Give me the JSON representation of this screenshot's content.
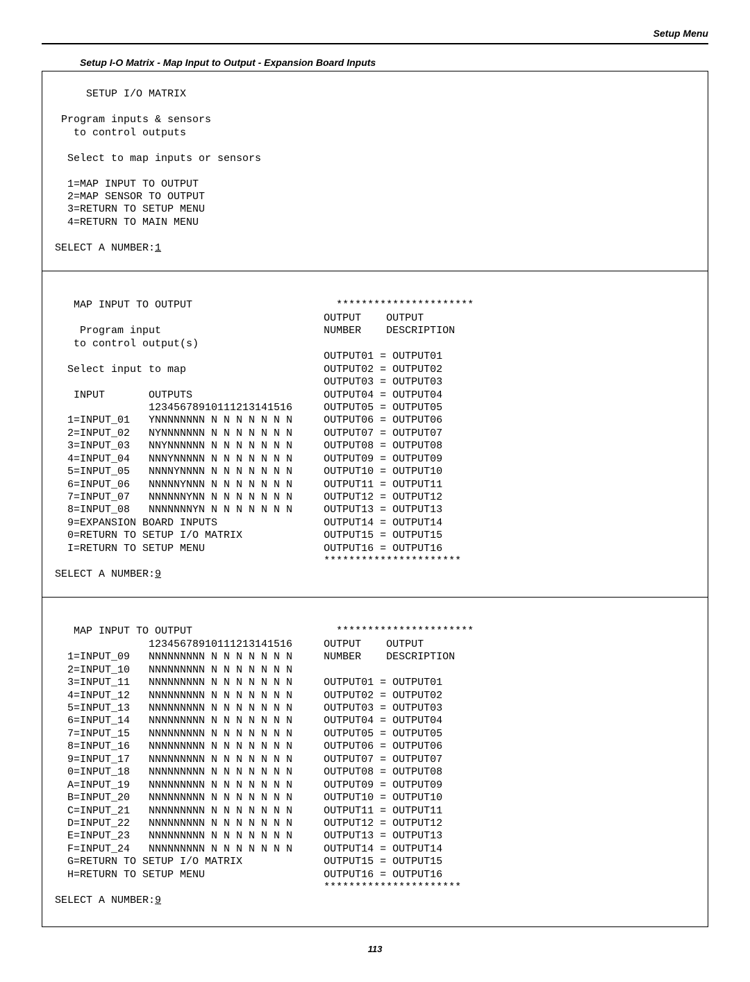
{
  "header": {
    "right": "Setup Menu"
  },
  "section_caption": "Setup I-O Matrix - Map Input to Output - Expansion Board Inputs",
  "page_number": "113",
  "block_a": {
    "title": "     SETUP I/O MATRIX",
    "lines": [
      " Program inputs & sensors",
      "   to control outputs",
      "",
      "  Select to map inputs or sensors",
      "",
      "  1=MAP INPUT TO OUTPUT",
      "  2=MAP SENSOR TO OUTPUT",
      "  3=RETURN TO SETUP MENU",
      "  4=RETURN TO MAIN MENU"
    ],
    "prompt": "SELECT A NUMBER:",
    "prompt_value": "1"
  },
  "block_b": {
    "stars": "**********************",
    "title": "   MAP INPUT TO OUTPUT",
    "hdr1": "OUTPUT    OUTPUT",
    "hdr2": "NUMBER    DESCRIPTION",
    "sub1": "    Program input",
    "sub2": "   to control output(s)",
    "sub3": "  Select input to map",
    "col_hdr_l": "   INPUT       OUTPUTS",
    "col_hdr_r": "OUTPUT04 = OUTPUT04",
    "numline": "               12345678910111213141516",
    "out_right_a": "OUTPUT01 = OUTPUT01",
    "out_right_b": "OUTPUT02 = OUTPUT02",
    "out_right_c": "OUTPUT03 = OUTPUT03",
    "out_right_e": "OUTPUT05 = OUTPUT05",
    "rows": [
      {
        "l": "  1=INPUT_01   YNNNNNNNN N N N N N N N",
        "r": "OUTPUT06 = OUTPUT06"
      },
      {
        "l": "  2=INPUT_02   NYNNNNNNN N N N N N N N",
        "r": "OUTPUT07 = OUTPUT07"
      },
      {
        "l": "  3=INPUT_03   NNYNNNNNN N N N N N N N",
        "r": "OUTPUT08 = OUTPUT08"
      },
      {
        "l": "  4=INPUT_04   NNNYNNNNN N N N N N N N",
        "r": "OUTPUT09 = OUTPUT09"
      },
      {
        "l": "  5=INPUT_05   NNNNYNNNN N N N N N N N",
        "r": "OUTPUT10 = OUTPUT10"
      },
      {
        "l": "  6=INPUT_06   NNNNNYNNN N N N N N N N",
        "r": "OUTPUT11 = OUTPUT11"
      },
      {
        "l": "  7=INPUT_07   NNNNNNYNN N N N N N N N",
        "r": "OUTPUT12 = OUTPUT12"
      },
      {
        "l": "  8=INPUT_08   NNNNNNNYN N N N N N N N",
        "r": "OUTPUT13 = OUTPUT13"
      },
      {
        "l": "  9=EXPANSION BOARD INPUTS",
        "r": "OUTPUT14 = OUTPUT14"
      },
      {
        "l": "  0=RETURN TO SETUP I/O MATRIX",
        "r": "OUTPUT15 = OUTPUT15"
      },
      {
        "l": "  I=RETURN TO SETUP MENU",
        "r": "OUTPUT16 = OUTPUT16"
      }
    ],
    "prompt": "SELECT A NUMBER:",
    "prompt_value": "9"
  },
  "block_c": {
    "stars": "**********************",
    "title": "   MAP INPUT TO OUTPUT",
    "numline_l": "               12345678910111213141516",
    "numline_r": "OUTPUT    OUTPUT",
    "line2_l": "  1=INPUT_09   NNNNNNNNN N N N N N N N",
    "line2_r": "NUMBER    DESCRIPTION",
    "line3": "  2=INPUT_10   NNNNNNNNN N N N N N N N",
    "rows": [
      {
        "l": "  3=INPUT_11   NNNNNNNNN N N N N N N N",
        "r": "OUTPUT01 = OUTPUT01"
      },
      {
        "l": "  4=INPUT_12   NNNNNNNNN N N N N N N N",
        "r": "OUTPUT02 = OUTPUT02"
      },
      {
        "l": "  5=INPUT_13   NNNNNNNNN N N N N N N N",
        "r": "OUTPUT03 = OUTPUT03"
      },
      {
        "l": "  6=INPUT_14   NNNNNNNNN N N N N N N N",
        "r": "OUTPUT04 = OUTPUT04"
      },
      {
        "l": "  7=INPUT_15   NNNNNNNNN N N N N N N N",
        "r": "OUTPUT05 = OUTPUT05"
      },
      {
        "l": "  8=INPUT_16   NNNNNNNNN N N N N N N N",
        "r": "OUTPUT06 = OUTPUT06"
      },
      {
        "l": "  9=INPUT_17   NNNNNNNNN N N N N N N N",
        "r": "OUTPUT07 = OUTPUT07"
      },
      {
        "l": "  0=INPUT_18   NNNNNNNNN N N N N N N N",
        "r": "OUTPUT08 = OUTPUT08"
      },
      {
        "l": "  A=INPUT_19   NNNNNNNNN N N N N N N N",
        "r": "OUTPUT09 = OUTPUT09"
      },
      {
        "l": "  B=INPUT_20   NNNNNNNNN N N N N N N N",
        "r": "OUTPUT10 = OUTPUT10"
      },
      {
        "l": "  C=INPUT_21   NNNNNNNNN N N N N N N N",
        "r": "OUTPUT11 = OUTPUT11"
      },
      {
        "l": "  D=INPUT_22   NNNNNNNNN N N N N N N N",
        "r": "OUTPUT12 = OUTPUT12"
      },
      {
        "l": "  E=INPUT_23   NNNNNNNNN N N N N N N N",
        "r": "OUTPUT13 = OUTPUT13"
      },
      {
        "l": "  F=INPUT_24   NNNNNNNNN N N N N N N N",
        "r": "OUTPUT14 = OUTPUT14"
      },
      {
        "l": "  G=RETURN TO SETUP I/O MATRIX",
        "r": "OUTPUT15 = OUTPUT15"
      },
      {
        "l": "  H=RETURN TO SETUP MENU",
        "r": "OUTPUT16 = OUTPUT16"
      }
    ],
    "prompt": "SELECT A NUMBER:",
    "prompt_value": "9"
  }
}
